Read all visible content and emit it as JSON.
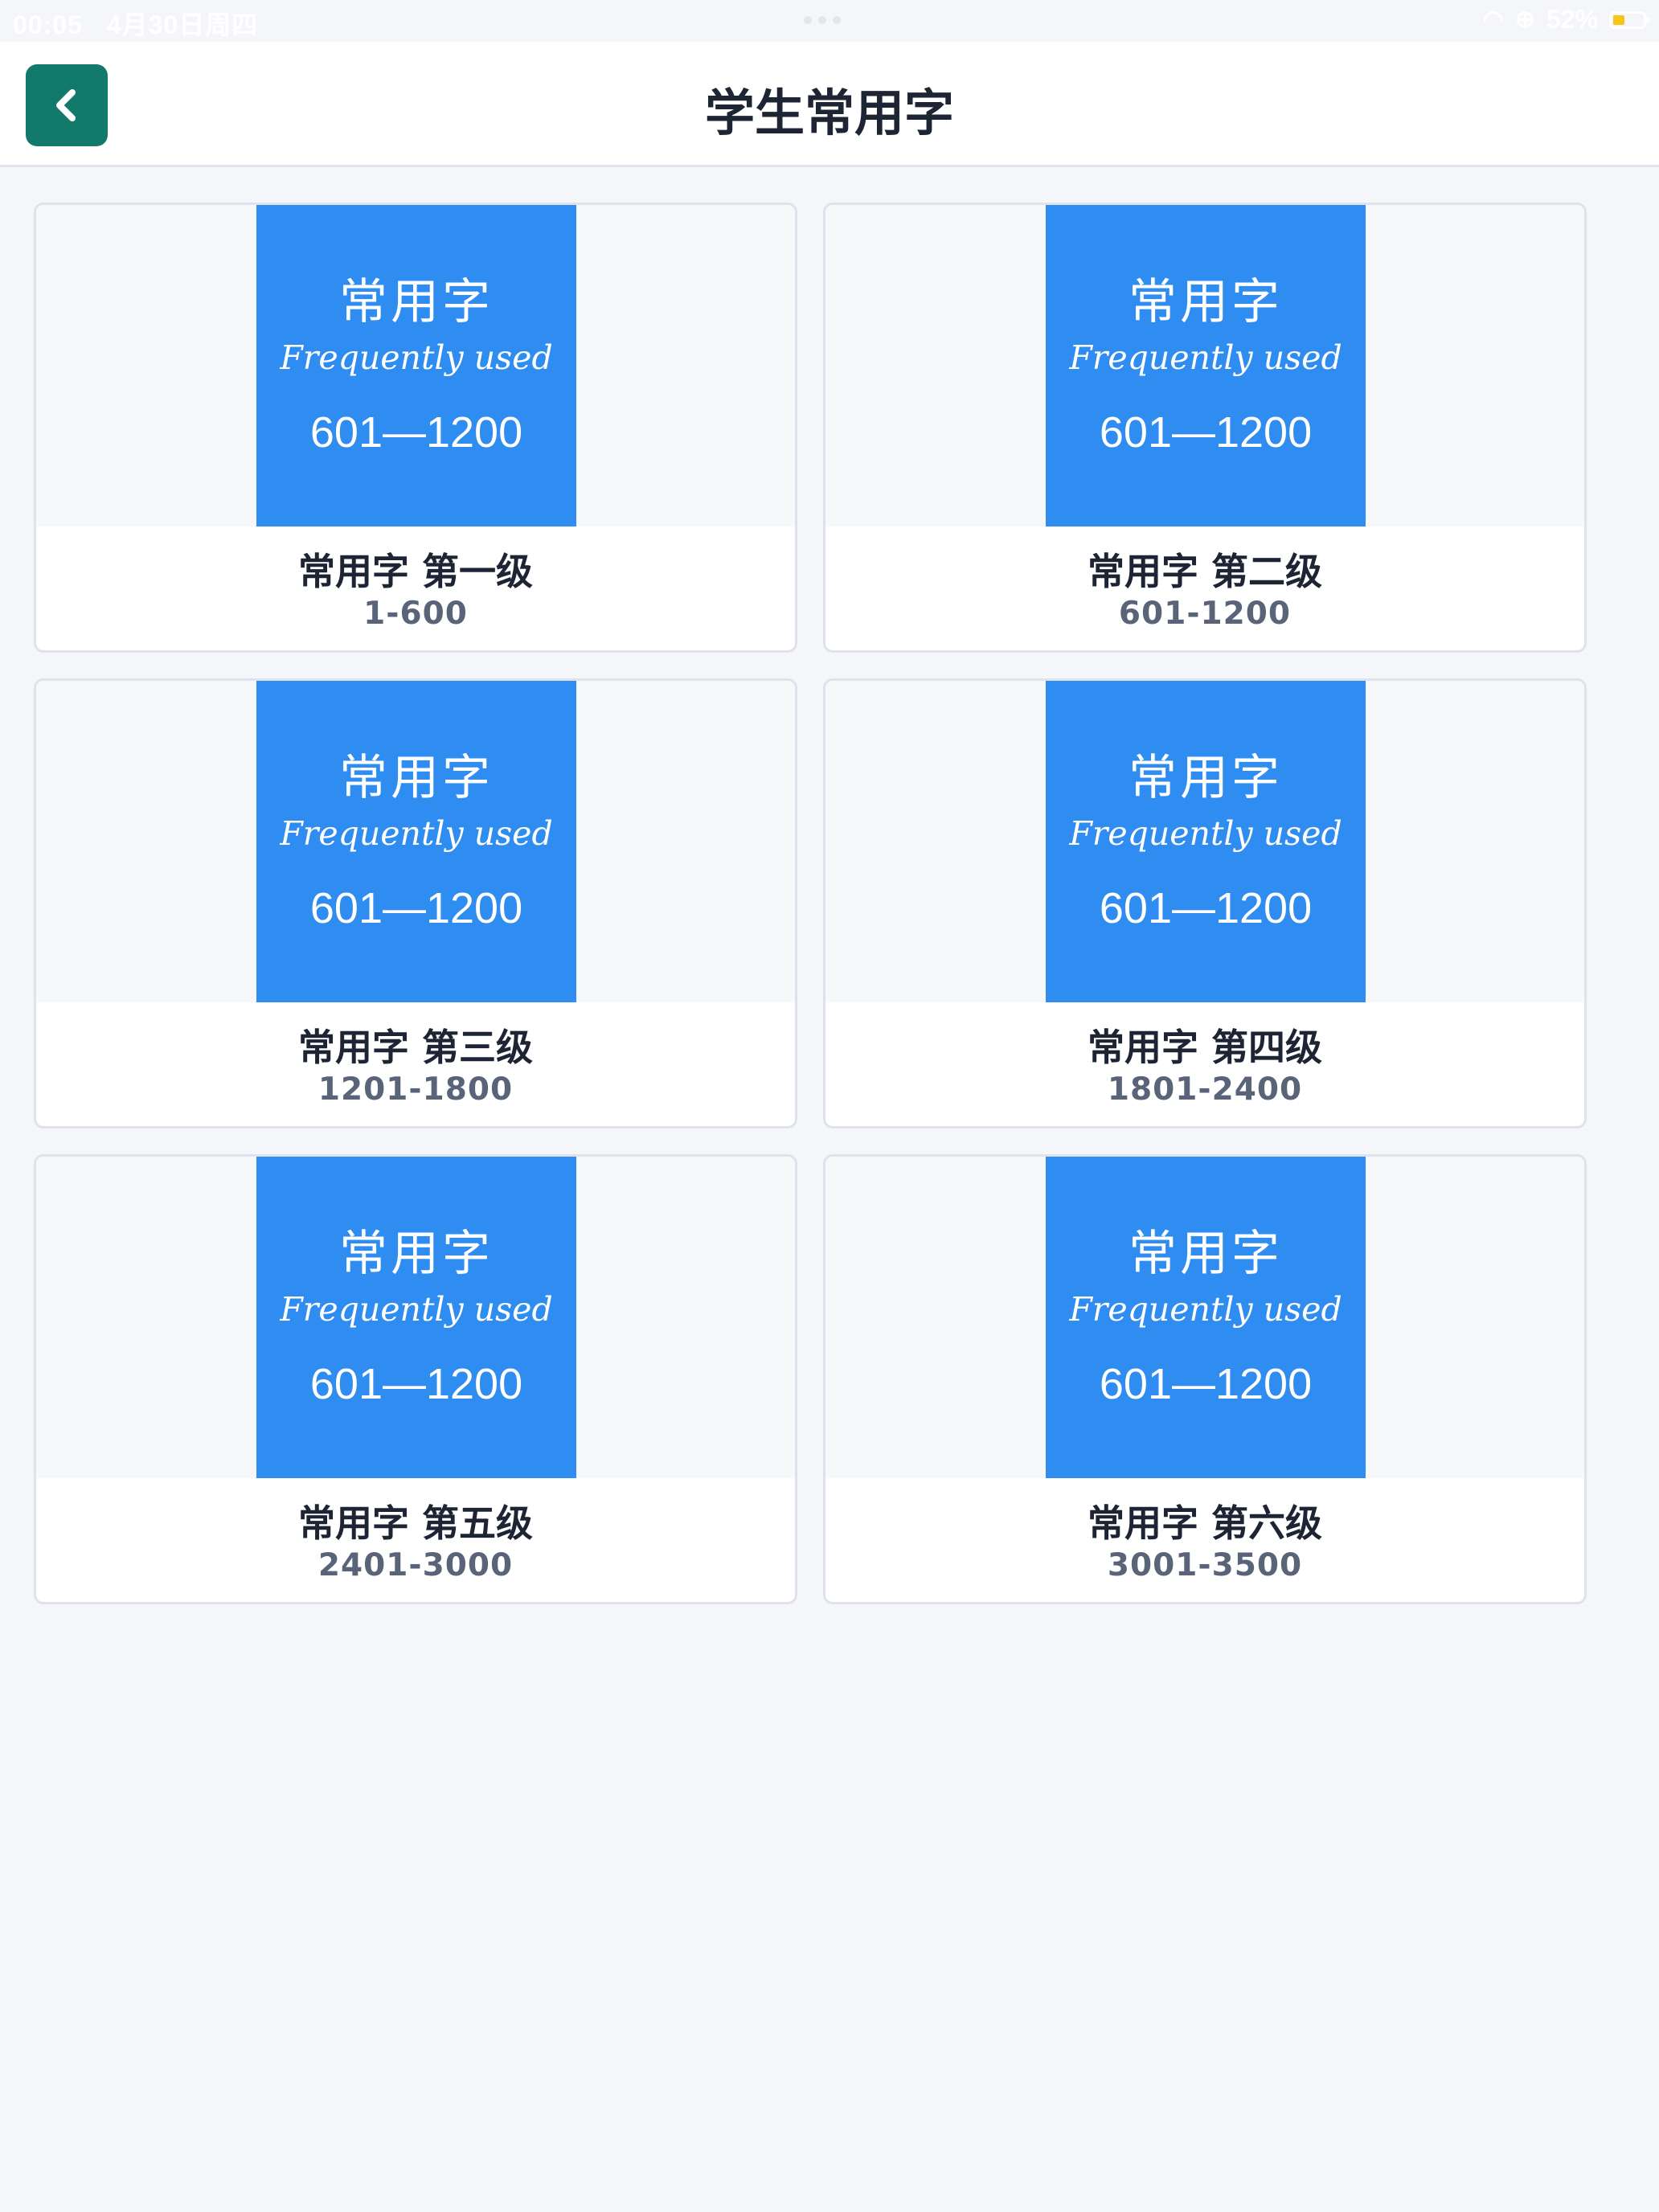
{
  "status_bar": {
    "time": "00:05",
    "date": "4月30日周四",
    "battery": "52%"
  },
  "header": {
    "title": "学生常用字"
  },
  "cards": [
    {
      "cover_title": "常用字",
      "cover_subtitle": "Frequently used",
      "cover_range": "601—1200",
      "title": "常用字 第一级",
      "range": "1-600"
    },
    {
      "cover_title": "常用字",
      "cover_subtitle": "Frequently used",
      "cover_range": "601—1200",
      "title": "常用字 第二级",
      "range": "601-1200"
    },
    {
      "cover_title": "常用字",
      "cover_subtitle": "Frequently used",
      "cover_range": "601—1200",
      "title": "常用字 第三级",
      "range": "1201-1800"
    },
    {
      "cover_title": "常用字",
      "cover_subtitle": "Frequently used",
      "cover_range": "601—1200",
      "title": "常用字 第四级",
      "range": "1801-2400"
    },
    {
      "cover_title": "常用字",
      "cover_subtitle": "Frequently used",
      "cover_range": "601—1200",
      "title": "常用字 第五级",
      "range": "2401-3000"
    },
    {
      "cover_title": "常用字",
      "cover_subtitle": "Frequently used",
      "cover_range": "601—1200",
      "title": "常用字 第六级",
      "range": "3001-3500"
    }
  ],
  "icons": {
    "back": "chevron-left-icon",
    "wifi": "wifi-icon",
    "rotation_lock": "lock-rotation-icon",
    "battery": "battery-icon"
  },
  "colors": {
    "accent": "#2f8cf1",
    "back_button": "#127a6a",
    "title_text": "#1d2433",
    "range_text": "#5a6478",
    "background": "#f5f6fa"
  }
}
